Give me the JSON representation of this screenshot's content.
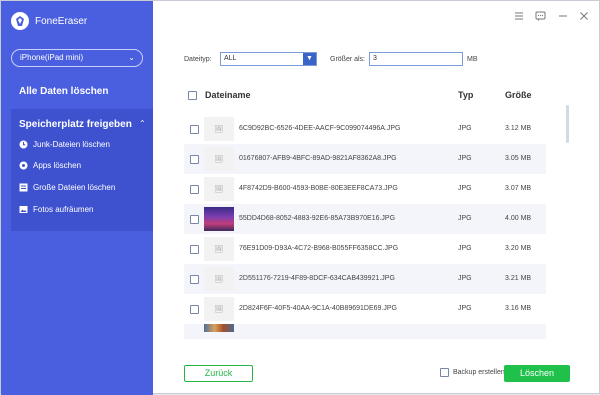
{
  "app": {
    "title": "FoneEraser"
  },
  "device": {
    "selected": "iPhone(iPad mini)"
  },
  "sidebar": {
    "main_item": "Alle Daten löschen",
    "group_title": "Speicherplatz freigeben",
    "items": [
      {
        "label": "Junk-Dateien löschen",
        "icon": "clock-icon"
      },
      {
        "label": "Apps löschen",
        "icon": "apps-icon"
      },
      {
        "label": "Große Dateien löschen",
        "icon": "large-files-icon",
        "active": true
      },
      {
        "label": "Fotos aufräumen",
        "icon": "photo-icon"
      }
    ]
  },
  "filters": {
    "type_label": "Dateityp:",
    "type_value": "ALL",
    "size_label": "Größer als:",
    "size_value": "3",
    "size_unit": "MB"
  },
  "table": {
    "headers": {
      "name": "Dateiname",
      "type": "Typ",
      "size": "Größe"
    },
    "rows": [
      {
        "name": "6C9D92BC-6526-4DEE-AACF-9C099074496A.JPG",
        "type": "JPG",
        "size": "3.12 MB"
      },
      {
        "name": "01676807-AFB9-4BFC-89AD-9821AF8362A8.JPG",
        "type": "JPG",
        "size": "3.05 MB"
      },
      {
        "name": "4F8742D9-B600-4593-B0BE-80E3EEF8CA73.JPG",
        "type": "JPG",
        "size": "3.07 MB"
      },
      {
        "name": "55DD4D68-8052-4883-92E6-85A73B970E16.JPG",
        "type": "JPG",
        "size": "4.00 MB"
      },
      {
        "name": "76E91D09-D93A-4C72-B968-B055FF6358CC.JPG",
        "type": "JPG",
        "size": "3.20 MB"
      },
      {
        "name": "2D551176-7219-4F89-8DCF-634CAB439921.JPG",
        "type": "JPG",
        "size": "3.21 MB"
      },
      {
        "name": "2D824F6F-40F5-40AA-9C1A-40B89691DE69.JPG",
        "type": "JPG",
        "size": "3.16 MB"
      }
    ]
  },
  "footer": {
    "back_label": "Zurück",
    "backup_label": "Backup erstellen",
    "delete_label": "Löschen"
  },
  "colors": {
    "sidebar": "#4a5fe0",
    "accent_green": "#1fc14a",
    "link_blue": "#3a64c8"
  }
}
